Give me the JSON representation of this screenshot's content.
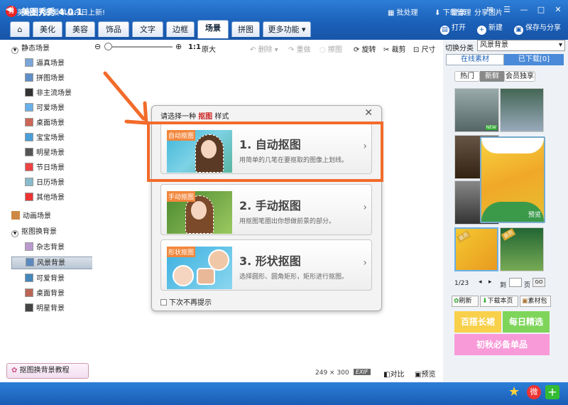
{
  "app": {
    "title": "美图秀秀 4.0.1",
    "logo_text": "秀",
    "login": "登录"
  },
  "tabs": [
    {
      "label": "⌂"
    },
    {
      "label": "美化"
    },
    {
      "label": "美容"
    },
    {
      "label": "饰品"
    },
    {
      "label": "文字"
    },
    {
      "label": "边框"
    },
    {
      "label": "场景"
    },
    {
      "label": "拼图"
    },
    {
      "label": "更多功能 ▾"
    }
  ],
  "header_actions": {
    "open": "打开",
    "new": "新建",
    "save": "保存与分享"
  },
  "sidebar": {
    "static_group": "静态场景",
    "static_items": [
      "逼真场景",
      "拼图场景",
      "非主流场景",
      "可爱场景",
      "桌面场景",
      "宝宝场景",
      "明星场景",
      "节日场景",
      "日历场景",
      "其他场景"
    ],
    "anim_group": "动画场景",
    "cutout_group": "抠图换背景",
    "cutout_items": [
      "杂志背景",
      "风景背景",
      "可爱背景",
      "桌面背景",
      "明星背景"
    ],
    "tutorial": "抠图换背景教程"
  },
  "toolbar": {
    "zoom_label": "1:1",
    "original": "原大",
    "delete": "删除",
    "redo": "重做",
    "erase": "擦图",
    "rotate": "旋转",
    "crop": "裁剪",
    "size": "尺寸"
  },
  "dialog": {
    "title_prefix": "请选择一种",
    "title_highlight": "抠图",
    "title_suffix": "样式",
    "options": [
      {
        "tag": "自动抠图",
        "title": "1. 自动抠图",
        "desc": "用简单的几笔在要抠取的图像上划线。"
      },
      {
        "tag": "手动抠图",
        "title": "2. 手动抠图",
        "desc": "用抠图笔圈出你想做前景的部分。"
      },
      {
        "tag": "形状抠图",
        "title": "3. 形状抠图",
        "desc": "选择圆形、圆角矩形，矩形进行抠图。"
      }
    ],
    "no_prompt": "下次不再提示"
  },
  "canvas_info": {
    "size": "249 × 300",
    "exif": "EXIF",
    "compare": "对比",
    "preview": "预览"
  },
  "right_panel": {
    "category_label": "切换分类",
    "category_value": "风景背景",
    "tab_online": "在线素材",
    "tab_downloaded": "已下载[0]",
    "subtabs": [
      "热门",
      "新鲜",
      "会员独享"
    ],
    "badge_new": "NEW",
    "preview_label": "预览",
    "member_label": "会员",
    "page": "1/23",
    "goto": "到",
    "page_unit": "页",
    "go": "GO",
    "refresh": "刷新",
    "download_page": "下载本页",
    "material": "素材包",
    "banners": [
      "百搭长裙",
      "每日精选",
      "初秋必备单品"
    ]
  },
  "status": {
    "news": "美图达人最爱单品今日上新!",
    "batch": "批处理",
    "download_mgr": "下载管理",
    "share": "分享图片"
  },
  "colors": {
    "titlebar": "#1a5fb8",
    "highlight_box": "#f26b2a",
    "dialog_tag": "#f2873d"
  }
}
